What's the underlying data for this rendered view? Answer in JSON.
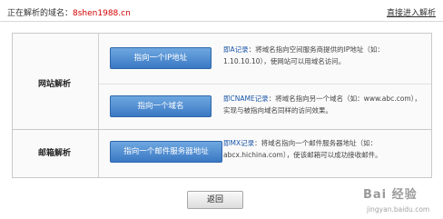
{
  "header": {
    "prefix": "正在解析的域名：",
    "domain": "8shen1988.cn",
    "link": "直接进入解析"
  },
  "sections": [
    {
      "label": "网站解析",
      "rows": [
        {
          "button": "指向一个IP地址",
          "record": "即A记录",
          "desc": "：将域名指向空间服务商提供的IP地址（如：1.10.10.10），使网站可以用域名访问。"
        },
        {
          "button": "指向一个域名",
          "record": "即CNAME记录",
          "desc": "：将域名指向另一个域名（如：www.abc.com），实现与被指向域名同样的访问效果。"
        }
      ]
    },
    {
      "label": "邮箱解析",
      "rows": [
        {
          "button": "指向一个邮件服务器地址",
          "record": "即MX记录",
          "desc": "：将域名指向一个邮件服务器地址（如：abcx.hichina.com），使该邮箱可以成功接收邮件。"
        }
      ]
    }
  ],
  "footer": {
    "back_label": "返回"
  },
  "watermark": {
    "logo": "Bai 经验",
    "sub": "jingyan.baidu.com"
  }
}
